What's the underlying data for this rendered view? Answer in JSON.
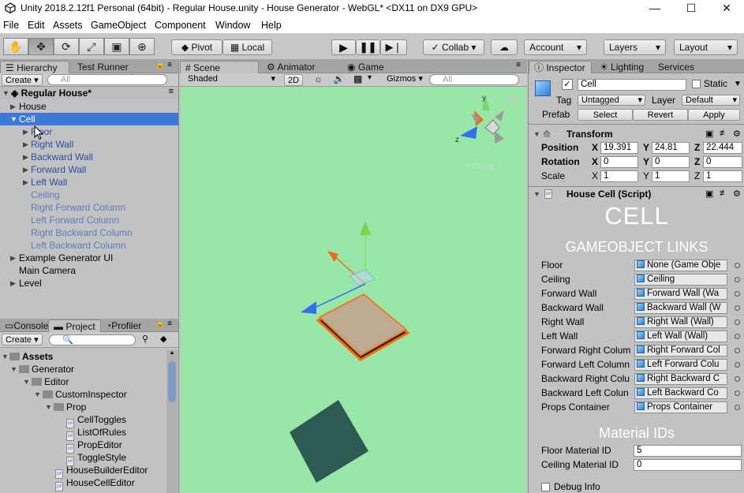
{
  "window": {
    "title": "Unity 2018.2.12f1 Personal (64bit) - Regular House.unity - House Generator - WebGL* <DX11 on DX9 GPU>",
    "minimize": "—",
    "maximize": "☐",
    "close": "✕"
  },
  "menu": [
    "File",
    "Edit",
    "Assets",
    "GameObject",
    "Component",
    "Window",
    "Help"
  ],
  "toolbar": {
    "pivot": "Pivot",
    "local": "Local",
    "collab": "Collab ▾",
    "account": "Account",
    "layers": "Layers",
    "layout": "Layout"
  },
  "hierarchy": {
    "tabs": [
      "Hierarchy",
      "Test Runner"
    ],
    "create": "Create ▾",
    "search_placeholder": "All",
    "scene": "Regular House*",
    "items": [
      {
        "label": "House"
      },
      {
        "label": "Cell"
      },
      {
        "label": "Floor"
      },
      {
        "label": "Right Wall"
      },
      {
        "label": "Backward Wall"
      },
      {
        "label": "Forward Wall"
      },
      {
        "label": "Left Wall"
      },
      {
        "label": "Ceiling"
      },
      {
        "label": "Right Forward Column"
      },
      {
        "label": "Left Forward Column"
      },
      {
        "label": "Right Backward Column"
      },
      {
        "label": "Left Backward Column"
      },
      {
        "label": "Example Generator UI"
      },
      {
        "label": "Main Camera"
      },
      {
        "label": "Level"
      }
    ]
  },
  "project": {
    "tabs": [
      "Console",
      "Project",
      "Profiler"
    ],
    "create": "Create ▾",
    "tree": [
      {
        "label": "Assets"
      },
      {
        "label": "Generator"
      },
      {
        "label": "Editor"
      },
      {
        "label": "CustomInspector"
      },
      {
        "label": "Prop"
      },
      {
        "label": "CellToggles"
      },
      {
        "label": "ListOfRules"
      },
      {
        "label": "PropEditor"
      },
      {
        "label": "ToggleStyle"
      },
      {
        "label": "HouseBuilderEditor"
      },
      {
        "label": "HouseCellEditor"
      }
    ]
  },
  "scene": {
    "tabs": [
      "Scene",
      "Animator",
      "Game"
    ],
    "shading": "Shaded",
    "mode_2d": "2D",
    "gizmos": "Gizmos ▾",
    "search_placeholder": "All",
    "persp": "≡ Persp",
    "axis_y": "y",
    "axis_z": "z"
  },
  "inspector": {
    "tabs": [
      "Inspector",
      "Lighting",
      "Services"
    ],
    "object_name": "Cell",
    "static": "Static",
    "tag_label": "Tag",
    "tag": "Untagged",
    "layer_label": "Layer",
    "layer": "Default",
    "prefab_label": "Prefab",
    "prefab_buttons": [
      "Select",
      "Revert",
      "Apply"
    ],
    "transform": {
      "title": "Transform",
      "position": {
        "label": "Position",
        "x": "19.391",
        "y": "24.81",
        "z": "22.444"
      },
      "rotation": {
        "label": "Rotation",
        "x": "0",
        "y": "0",
        "z": "0"
      },
      "scale": {
        "label": "Scale",
        "x": "1",
        "y": "1",
        "z": "1"
      }
    },
    "script": {
      "title": "House Cell (Script)",
      "heading": "CELL",
      "links_heading": "GAMEOBJECT LINKS",
      "links": [
        {
          "label": "Floor",
          "value": "None (Game Obje"
        },
        {
          "label": "Ceiling",
          "value": "Ceiling"
        },
        {
          "label": "Forward Wall",
          "value": "Forward Wall (Wa"
        },
        {
          "label": "Backward Wall",
          "value": "Backward Wall (W"
        },
        {
          "label": "Right Wall",
          "value": "Right Wall (Wall)"
        },
        {
          "label": "Left Wall",
          "value": "Left Wall (Wall)"
        },
        {
          "label": "Forward Right Colum",
          "value": "Right Forward Col"
        },
        {
          "label": "Forward Left Column",
          "value": "Left Forward Colu"
        },
        {
          "label": "Backward Right Colu",
          "value": "Right Backward C"
        },
        {
          "label": "Backward Left Colun",
          "value": "Left Backward Co"
        },
        {
          "label": "Props Container",
          "value": "Props Container"
        }
      ],
      "material_heading": "Material IDs",
      "floor_material": {
        "label": "Floor Material ID",
        "value": "5"
      },
      "ceiling_material": {
        "label": "Ceiling Material ID",
        "value": "0"
      },
      "debug": "Debug Info"
    }
  },
  "colors": {
    "scene_bg": "#99e6a9",
    "selection": "#3c78d8",
    "floor_tile": "#b9a48a",
    "dark_cube": "#2d5a52"
  }
}
